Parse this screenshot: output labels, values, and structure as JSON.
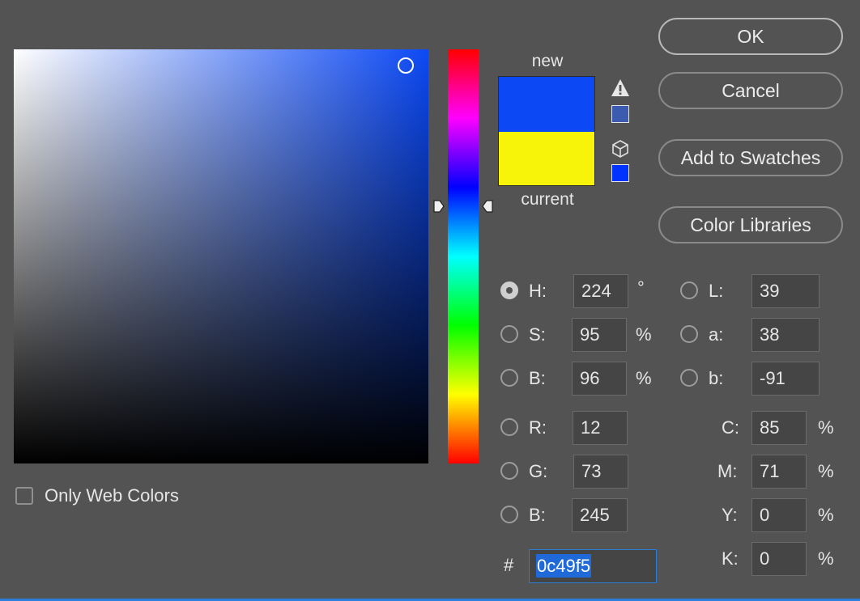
{
  "swatch": {
    "new_label": "new",
    "current_label": "current",
    "new_color": "#0c49f5",
    "current_color": "#f7f409",
    "gamut_color": "#3a5bb0",
    "websafe_color": "#0033ff"
  },
  "icons": {
    "warning": "warning-triangle-icon",
    "cube": "web-safe-cube-icon"
  },
  "buttons": {
    "ok": "OK",
    "cancel": "Cancel",
    "add_to_swatches": "Add to Swatches",
    "color_libraries": "Color Libraries"
  },
  "hsb": {
    "h": {
      "label": "H:",
      "value": "224",
      "unit": "°",
      "selected": true
    },
    "s": {
      "label": "S:",
      "value": "95",
      "unit": "%"
    },
    "b": {
      "label": "B:",
      "value": "96",
      "unit": "%"
    }
  },
  "rgb": {
    "r": {
      "label": "R:",
      "value": "12"
    },
    "g": {
      "label": "G:",
      "value": "73"
    },
    "b": {
      "label": "B:",
      "value": "245"
    }
  },
  "lab": {
    "l": {
      "label": "L:",
      "value": "39"
    },
    "a": {
      "label": "a:",
      "value": "38"
    },
    "b": {
      "label": "b:",
      "value": "-91"
    }
  },
  "cmyk": {
    "c": {
      "label": "C:",
      "value": "85",
      "unit": "%"
    },
    "m": {
      "label": "M:",
      "value": "71",
      "unit": "%"
    },
    "y": {
      "label": "Y:",
      "value": "0",
      "unit": "%"
    },
    "k": {
      "label": "K:",
      "value": "0",
      "unit": "%"
    }
  },
  "hex": {
    "label": "#",
    "value": "0c49f5"
  },
  "web_colors": {
    "label": "Only Web Colors",
    "checked": false
  }
}
